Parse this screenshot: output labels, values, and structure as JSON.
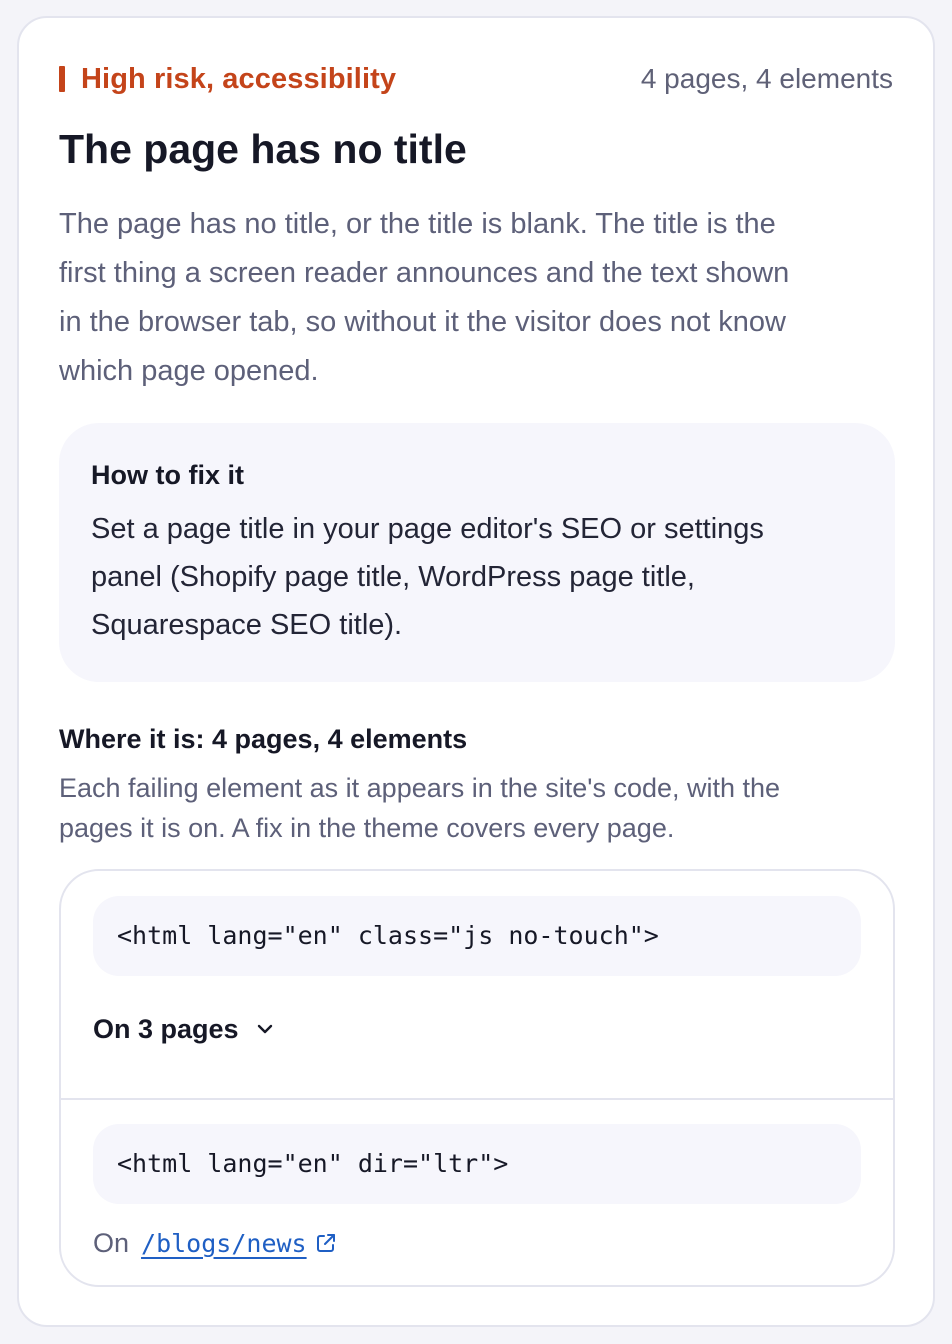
{
  "header": {
    "risk_label": "High risk, accessibility",
    "count_label": "4 pages, 4 elements",
    "risk_color": "#c4441a"
  },
  "issue": {
    "title": "The page has no title",
    "description": "The page has no title, or the title is blank. The title is the first thing a screen reader announces and the text shown in the browser tab, so without it the visitor does not know which page opened."
  },
  "fix": {
    "heading": "How to fix it",
    "text": "Set a page title in your page editor's SEO or settings panel (Shopify page title, WordPress page title, Squarespace SEO title)."
  },
  "where": {
    "heading": "Where it is: 4 pages, 4 elements",
    "description": "Each failing element as it appears in the site's code, with the pages it is on. A fix in the theme covers every page."
  },
  "elements": [
    {
      "code": "<html lang=\"en\" class=\"js no-touch\">",
      "pages_toggle_label": "On 3 pages",
      "toggle_icon": "chevron-down-icon"
    },
    {
      "code": "<html lang=\"en\" dir=\"ltr\">",
      "on_prefix": "On",
      "page_link": "/blogs/news",
      "link_icon": "external-link-icon",
      "link_color": "#1f5fc4"
    }
  ]
}
